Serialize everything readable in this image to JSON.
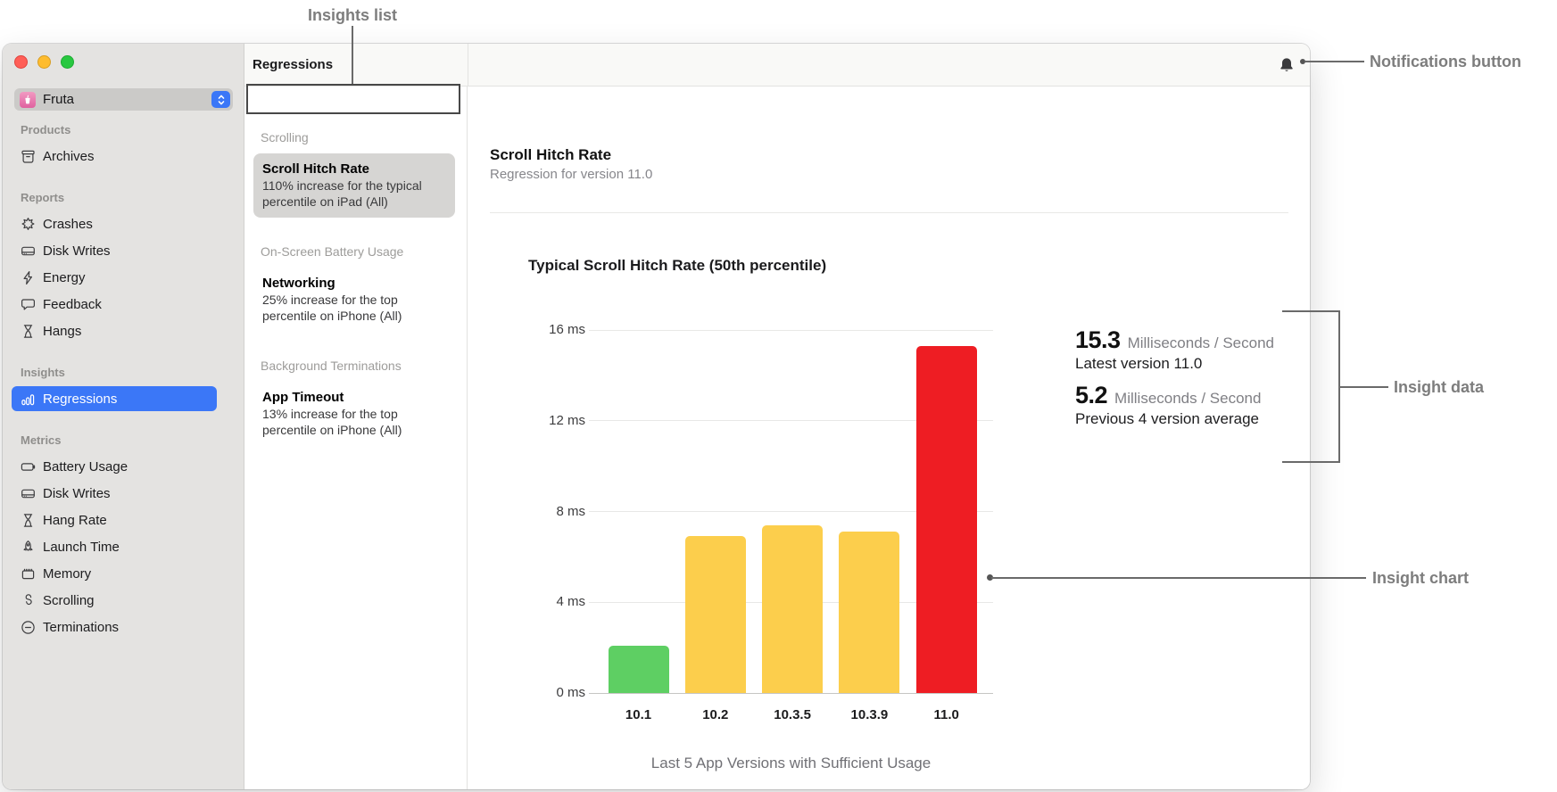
{
  "annotations": {
    "insights_list": "Insights list",
    "notifications_button": "Notifications button",
    "insight_data": "Insight data",
    "insight_chart": "Insight chart"
  },
  "window": {
    "app_selector": {
      "value": "Fruta",
      "icon": "fruta-app-icon"
    },
    "sidebar": {
      "sections": [
        {
          "label": "Products",
          "items": [
            {
              "label": "Archives",
              "icon": "archive-box-icon"
            }
          ]
        },
        {
          "label": "Reports",
          "items": [
            {
              "label": "Crashes",
              "icon": "crash-burst-icon"
            },
            {
              "label": "Disk Writes",
              "icon": "internal-drive-icon"
            },
            {
              "label": "Energy",
              "icon": "bolt-icon"
            },
            {
              "label": "Feedback",
              "icon": "speech-bubble-icon"
            },
            {
              "label": "Hangs",
              "icon": "hourglass-icon"
            }
          ]
        },
        {
          "label": "Insights",
          "items": [
            {
              "label": "Regressions",
              "icon": "bar-chart-icon",
              "selected": true
            }
          ]
        },
        {
          "label": "Metrics",
          "items": [
            {
              "label": "Battery Usage",
              "icon": "battery-icon"
            },
            {
              "label": "Disk Writes",
              "icon": "internal-drive-icon"
            },
            {
              "label": "Hang Rate",
              "icon": "hourglass-icon"
            },
            {
              "label": "Launch Time",
              "icon": "rocket-icon"
            },
            {
              "label": "Memory",
              "icon": "memory-chip-icon"
            },
            {
              "label": "Scrolling",
              "icon": "scroll-icon"
            },
            {
              "label": "Terminations",
              "icon": "circle-minus-icon"
            }
          ]
        }
      ]
    },
    "insights_list": {
      "title": "Regressions",
      "groups": [
        {
          "header": "Scrolling",
          "items": [
            {
              "title": "Scroll Hitch Rate",
              "description": "110% increase for the typical percentile on iPad (All)",
              "selected": true
            }
          ]
        },
        {
          "header": "On-Screen Battery Usage",
          "items": [
            {
              "title": "Networking",
              "description": "25% increase for the top percentile on iPhone (All)",
              "selected": false
            }
          ]
        },
        {
          "header": "Background Terminations",
          "items": [
            {
              "title": "App Timeout",
              "description": "13% increase for the top percentile on iPhone (All)",
              "selected": false
            }
          ]
        }
      ]
    },
    "detail": {
      "title": "Scroll Hitch Rate",
      "subtitle": "Regression for version 11.0",
      "stats": [
        {
          "value": "15.3",
          "unit": "Milliseconds / Second",
          "caption": "Latest version 11.0"
        },
        {
          "value": "5.2",
          "unit": "Milliseconds / Second",
          "caption": "Previous 4 version average"
        }
      ]
    }
  },
  "chart_data": {
    "type": "bar",
    "title": "Typical Scroll Hitch Rate (50th percentile)",
    "categories": [
      "10.1",
      "10.2",
      "10.3.5",
      "10.3.9",
      "11.0"
    ],
    "values": [
      2.1,
      6.9,
      7.4,
      7.1,
      15.3
    ],
    "unit": "ms",
    "bar_colors": [
      "#5ecf63",
      "#fcce4c",
      "#fcce4c",
      "#fcce4c",
      "#ee1d23"
    ],
    "yticks": [
      {
        "value": 0,
        "label": "0 ms"
      },
      {
        "value": 4,
        "label": "4 ms"
      },
      {
        "value": 8,
        "label": "8 ms"
      },
      {
        "value": 12,
        "label": "12 ms"
      },
      {
        "value": 16,
        "label": "16 ms"
      }
    ],
    "ylim": [
      0,
      16
    ],
    "xlabel": "Last 5 App Versions with Sufficient Usage",
    "grid": true,
    "legend": "none",
    "status_colors": {
      "good": "#5ecf63",
      "warning": "#fcce4c",
      "regression": "#ee1d23"
    }
  }
}
